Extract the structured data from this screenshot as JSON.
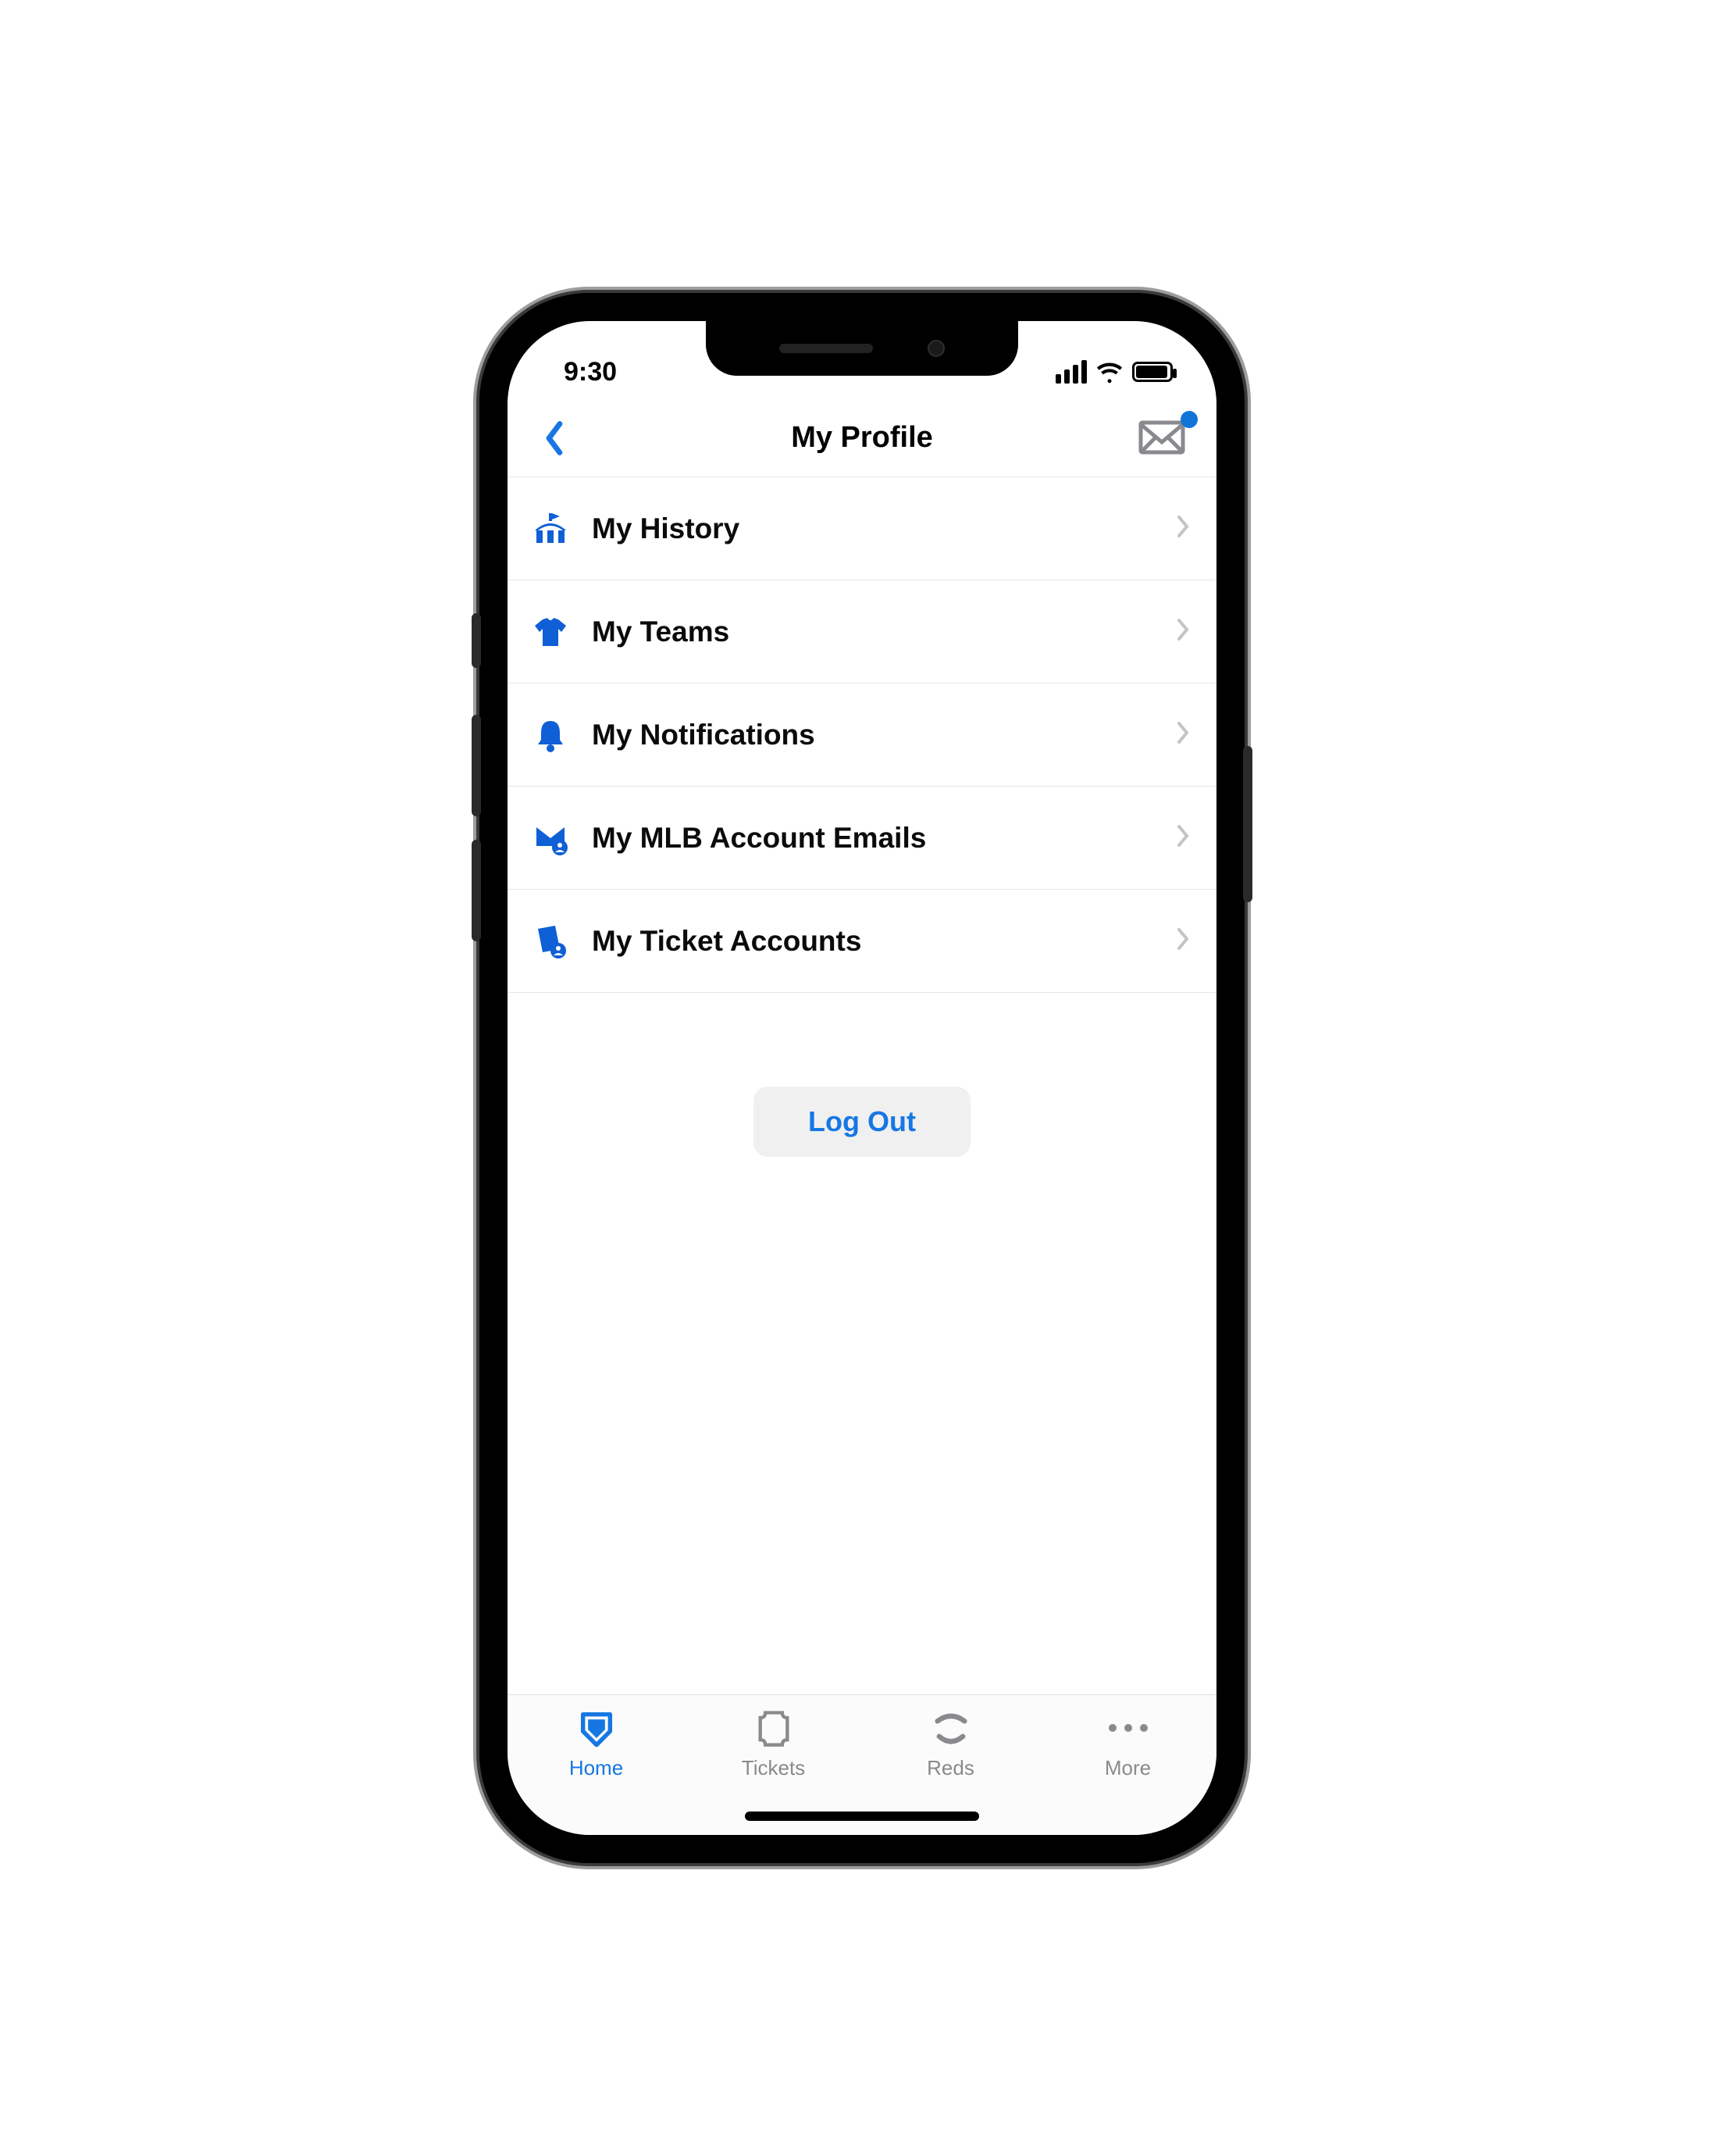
{
  "status": {
    "time": "9:30"
  },
  "header": {
    "title": "My Profile"
  },
  "menu": {
    "items": [
      {
        "label": "My History",
        "icon": "stadium-icon"
      },
      {
        "label": "My Teams",
        "icon": "jersey-icon"
      },
      {
        "label": "My Notifications",
        "icon": "bell-icon"
      },
      {
        "label": "My MLB Account Emails",
        "icon": "email-account-icon"
      },
      {
        "label": "My Ticket Accounts",
        "icon": "ticket-account-icon"
      }
    ]
  },
  "logout": {
    "label": "Log Out"
  },
  "tabs": {
    "items": [
      {
        "label": "Home",
        "active": true
      },
      {
        "label": "Tickets",
        "active": false
      },
      {
        "label": "Reds",
        "active": false
      },
      {
        "label": "More",
        "active": false
      }
    ]
  },
  "colors": {
    "accent": "#1677e3",
    "icon_blue": "#0f5fd6"
  }
}
